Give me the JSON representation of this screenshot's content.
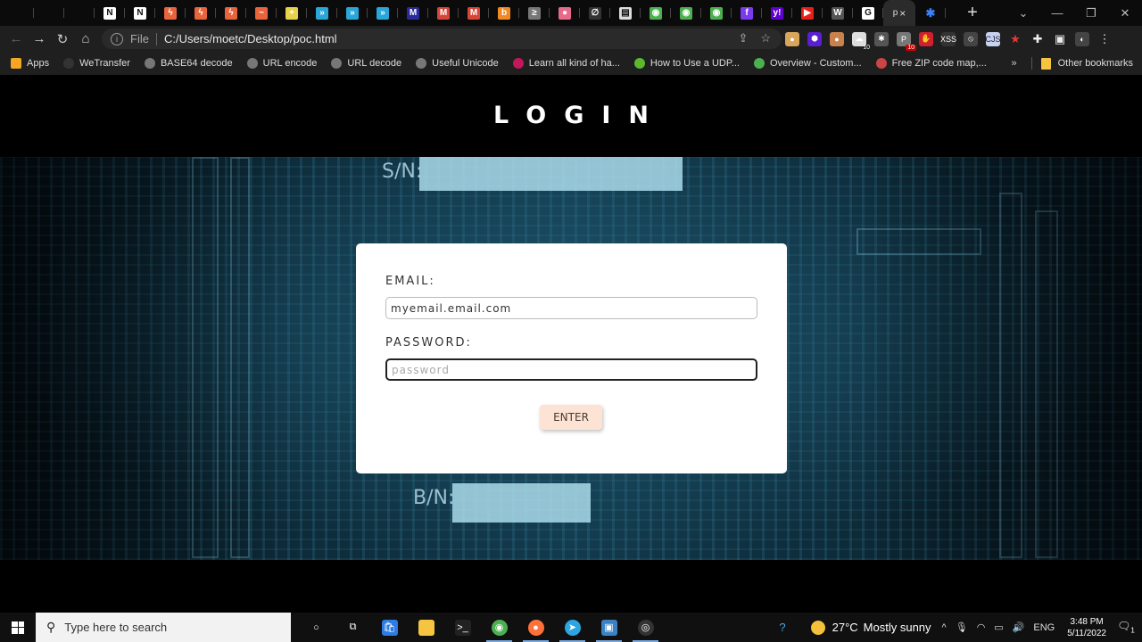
{
  "browser": {
    "tabs": [
      {
        "icon": "blank-favicon",
        "color": "#222222",
        "glyph": ""
      },
      {
        "icon": "blank-favicon",
        "color": "#222222",
        "glyph": ""
      },
      {
        "icon": "blank-favicon",
        "color": "#222222",
        "glyph": ""
      },
      {
        "icon": "notion-favicon",
        "color": "#ffffff",
        "glyph": "N"
      },
      {
        "icon": "notion-favicon",
        "color": "#ffffff",
        "glyph": "N"
      },
      {
        "icon": "bolt-favicon",
        "color": "#e8643a",
        "glyph": "ϟ"
      },
      {
        "icon": "bolt-favicon",
        "color": "#e8643a",
        "glyph": "ϟ"
      },
      {
        "icon": "bolt-favicon",
        "color": "#e8643a",
        "glyph": "ϟ"
      },
      {
        "icon": "wave-favicon",
        "color": "#e8643a",
        "glyph": "~"
      },
      {
        "icon": "plus-circle-favicon",
        "color": "#e6d34a",
        "glyph": "+"
      },
      {
        "icon": "chevron-favicon",
        "color": "#2aa6d8",
        "glyph": "»"
      },
      {
        "icon": "chevron-favicon",
        "color": "#2aa6d8",
        "glyph": "»"
      },
      {
        "icon": "chevron-favicon",
        "color": "#2aa6d8",
        "glyph": "»"
      },
      {
        "icon": "gmail-favicon",
        "color": "#2a2a9a",
        "glyph": "M"
      },
      {
        "icon": "gmail-favicon",
        "color": "#d44638",
        "glyph": "M"
      },
      {
        "icon": "gmail-favicon",
        "color": "#d44638",
        "glyph": "M"
      },
      {
        "icon": "b-favicon",
        "color": "#f08a24",
        "glyph": "b"
      },
      {
        "icon": "terminal-favicon",
        "color": "#777777",
        "glyph": "≥"
      },
      {
        "icon": "dots-favicon",
        "color": "#e86a8a",
        "glyph": "●"
      },
      {
        "icon": "slash-favicon",
        "color": "#333333",
        "glyph": "∅"
      },
      {
        "icon": "map-favicon",
        "color": "#dddddd",
        "glyph": "▤"
      },
      {
        "icon": "chrome-favicon",
        "color": "#4caf50",
        "glyph": "◉"
      },
      {
        "icon": "chrome-favicon",
        "color": "#4caf50",
        "glyph": "◉"
      },
      {
        "icon": "chrome-favicon",
        "color": "#4caf50",
        "glyph": "◉"
      },
      {
        "icon": "f-favicon",
        "color": "#7c3aed",
        "glyph": "f"
      },
      {
        "icon": "yahoo-favicon",
        "color": "#6001d2",
        "glyph": "y!"
      },
      {
        "icon": "youtube-favicon",
        "color": "#e62117",
        "glyph": "▶"
      },
      {
        "icon": "w-favicon",
        "color": "#555555",
        "glyph": "W"
      },
      {
        "icon": "google-favicon",
        "color": "#ffffff",
        "glyph": "G"
      }
    ],
    "active_tab": {
      "title_fragment": "p",
      "close": "×"
    },
    "pinned_after": {
      "icon": "puzzle-favicon",
      "color": "#3b82f6",
      "glyph": "✱"
    },
    "new_tab": "+",
    "window_controls": {
      "dropdown": "⌄",
      "minimize": "—",
      "restore": "❐",
      "close": "✕"
    },
    "nav": {
      "back": "←",
      "forward": "→",
      "reload": "↻",
      "home": "⌂"
    },
    "omnibox": {
      "info": "i",
      "scheme": "File",
      "url": "C:/Users/moetc/Desktop/poc.html",
      "share": "⇪",
      "bookmark": "☆"
    },
    "extensions": [
      {
        "icon": "cookie-extension-icon",
        "color": "#d9a55a",
        "glyph": "●",
        "badge": ""
      },
      {
        "icon": "hexagon-extension-icon",
        "color": "#5a1fd1",
        "glyph": "⬢",
        "badge": ""
      },
      {
        "icon": "cookie2-extension-icon",
        "color": "#c9824b",
        "glyph": "●",
        "badge": ""
      },
      {
        "icon": "cloud-extension-icon",
        "color": "#dddddd",
        "glyph": "☁",
        "badge": "10",
        "badge_style": "plain"
      },
      {
        "icon": "bug-extension-icon",
        "color": "#555555",
        "glyph": "✱",
        "badge": ""
      },
      {
        "icon": "p-extension-icon",
        "color": "#777777",
        "glyph": "P",
        "badge": "10"
      },
      {
        "icon": "stop-hand-extension-icon",
        "color": "#d01f2f",
        "glyph": "✋",
        "badge": ""
      },
      {
        "icon": "xss-extension-icon",
        "color": "#333333",
        "glyph": "XSS",
        "badge": ""
      },
      {
        "icon": "block-extension-icon",
        "color": "#444444",
        "glyph": "⦸",
        "badge": ""
      },
      {
        "icon": "cjs-extension-icon",
        "color": "#c7d2f0",
        "glyph": "CJS",
        "badge": ""
      },
      {
        "icon": "star-extension-icon",
        "color": "#1f1f1f",
        "glyph": "★",
        "badge": ""
      },
      {
        "icon": "puzzle-extension-icon",
        "color": "#1f1f1f",
        "glyph": "✚",
        "badge": ""
      },
      {
        "icon": "sidepanel-icon",
        "color": "#1f1f1f",
        "glyph": "▣",
        "badge": ""
      },
      {
        "icon": "profile-avatar",
        "color": "#444444",
        "glyph": "◐",
        "badge": ""
      },
      {
        "icon": "kebab-menu-icon",
        "color": "#1f1f1f",
        "glyph": "⋮",
        "badge": ""
      }
    ],
    "bookmarks": [
      {
        "label": "Apps",
        "icon": "apps-grid-icon",
        "color": "#f5a623"
      },
      {
        "label": "WeTransfer",
        "icon": "wetransfer-icon",
        "color": "#333333"
      },
      {
        "label": "BASE64 decode",
        "icon": "globe-icon",
        "color": "#777777"
      },
      {
        "label": "URL encode",
        "icon": "globe-icon",
        "color": "#777777"
      },
      {
        "label": "URL decode",
        "icon": "globe-icon",
        "color": "#777777"
      },
      {
        "label": "Useful Unicode",
        "icon": "globe-icon",
        "color": "#777777"
      },
      {
        "label": "Learn all kind of ha...",
        "icon": "gear-flower-icon",
        "color": "#c2185b"
      },
      {
        "label": "How to Use a UDP...",
        "icon": "wikihow-icon",
        "color": "#5cb82f"
      },
      {
        "label": "Overview - Custom...",
        "icon": "circle-green-icon",
        "color": "#4caf50"
      },
      {
        "label": "Free ZIP code map,...",
        "icon": "map-flag-icon",
        "color": "#c44"
      }
    ],
    "bookmarks_overflow": "»",
    "other_bookmarks": "Other bookmarks"
  },
  "page": {
    "title": "LOGIN",
    "pcb_labels": {
      "sn": "S/N:",
      "bn": "B/N:"
    },
    "form": {
      "email_label": "EMAIL:",
      "email_value": "myemail.email.com",
      "password_label": "PASSWORD:",
      "password_placeholder": "password",
      "password_value": "",
      "submit_label": "ENTER"
    }
  },
  "taskbar": {
    "start": "Start",
    "search_placeholder": "Type here to search",
    "apps": [
      {
        "name": "cortana-icon",
        "color": "#101010",
        "glyph": "○",
        "running": false
      },
      {
        "name": "task-view-icon",
        "color": "#101010",
        "glyph": "⧉",
        "running": false
      },
      {
        "name": "ms-store-icon",
        "color": "#2d7be5",
        "glyph": "🛍",
        "running": false
      },
      {
        "name": "file-explorer-icon",
        "color": "#f5c542",
        "glyph": "",
        "running": false
      },
      {
        "name": "terminal-icon",
        "color": "#222222",
        "glyph": ">_",
        "running": false
      },
      {
        "name": "chrome-icon",
        "color": "#4caf50",
        "glyph": "◉",
        "running": true
      },
      {
        "name": "firefox-icon",
        "color": "#ff7139",
        "glyph": "●",
        "running": true
      },
      {
        "name": "telegram-icon",
        "color": "#2ca5e0",
        "glyph": "➤",
        "running": true
      },
      {
        "name": "app-window-icon",
        "color": "#3b82c4",
        "glyph": "▣",
        "running": true
      },
      {
        "name": "obs-icon",
        "color": "#333333",
        "glyph": "◎",
        "running": true
      }
    ],
    "help_icon": "?",
    "weather": {
      "temp": "27°C",
      "desc": "Mostly sunny"
    },
    "tray": {
      "chevron": "^",
      "mic": "🎙",
      "wifi": "◠",
      "battery": "▭",
      "volume": "🔊",
      "lang": "ENG"
    },
    "clock": {
      "time": "3:48 PM",
      "date": "5/11/2022"
    },
    "notifications": {
      "count": "1"
    }
  }
}
